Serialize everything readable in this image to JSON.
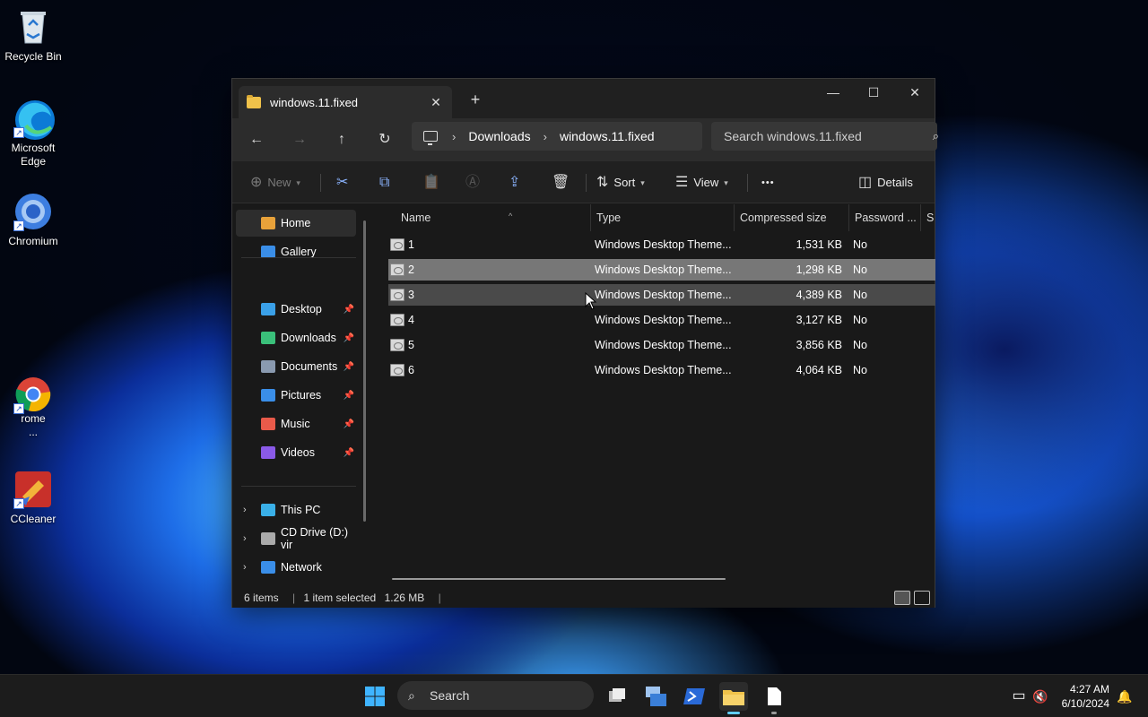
{
  "desktop": {
    "icons": [
      {
        "label": "Recycle Bin",
        "icon": "recycle-bin-icon"
      },
      {
        "label": "Microsoft Edge",
        "icon": "edge-icon"
      },
      {
        "label": "Chromium",
        "icon": "chromium-icon"
      },
      {
        "label": "rome ...",
        "icon": "chrome-icon"
      },
      {
        "label": "CCleaner",
        "icon": "ccleaner-icon"
      }
    ]
  },
  "explorer": {
    "tab_title": "windows.11.fixed",
    "tab_close": "✕",
    "new_tab": "+",
    "caption": {
      "minimize": "—",
      "maximize": "☐",
      "close": "✕"
    },
    "nav": {
      "back": "←",
      "forward": "→",
      "up": "↑",
      "refresh": "↻"
    },
    "breadcrumb": [
      "Downloads",
      "windows.11.fixed"
    ],
    "search_placeholder": "Search windows.11.fixed",
    "commands": {
      "new": "New",
      "sort": "Sort",
      "view": "View",
      "more": "•••",
      "details": "Details",
      "cut": "✂",
      "copy": "⧉",
      "paste": "📋",
      "rename": "Ⓐ",
      "share": "⇪",
      "delete": "🗑"
    },
    "sidebar": {
      "items": [
        {
          "label": "Home",
          "icon": "home-icon",
          "color": "#e8a23a"
        },
        {
          "label": "Gallery",
          "icon": "gallery-icon",
          "color": "#3a8ee8"
        },
        {
          "label": "Desktop",
          "icon": "desktop-folder-icon",
          "color": "#3aa0e8",
          "pinned": true
        },
        {
          "label": "Downloads",
          "icon": "downloads-folder-icon",
          "color": "#3ac07a",
          "pinned": true
        },
        {
          "label": "Documents",
          "icon": "documents-folder-icon",
          "color": "#8a9ab0",
          "pinned": true
        },
        {
          "label": "Pictures",
          "icon": "pictures-folder-icon",
          "color": "#3a8ee8",
          "pinned": true
        },
        {
          "label": "Music",
          "icon": "music-folder-icon",
          "color": "#e85a4a",
          "pinned": true
        },
        {
          "label": "Videos",
          "icon": "videos-folder-icon",
          "color": "#8a5ae8",
          "pinned": true
        },
        {
          "label": "This PC",
          "icon": "this-pc-icon",
          "color": "#3ab0e8"
        },
        {
          "label": "CD Drive (D:) vir",
          "icon": "cd-drive-icon",
          "color": "#aaaaaa"
        },
        {
          "label": "Network",
          "icon": "network-icon",
          "color": "#3a8ee8"
        }
      ],
      "pin_glyph": "📌",
      "expand_glyph": "›"
    },
    "columns": [
      "Name",
      "Type",
      "Compressed size",
      "Password ...",
      "Si"
    ],
    "sort_indicator": "^",
    "files": [
      {
        "name": "1",
        "type": "Windows Desktop Theme...",
        "size": "1,531 KB",
        "password": "No"
      },
      {
        "name": "2",
        "type": "Windows Desktop Theme...",
        "size": "1,298 KB",
        "password": "No"
      },
      {
        "name": "3",
        "type": "Windows Desktop Theme...",
        "size": "4,389 KB",
        "password": "No"
      },
      {
        "name": "4",
        "type": "Windows Desktop Theme...",
        "size": "3,127 KB",
        "password": "No"
      },
      {
        "name": "5",
        "type": "Windows Desktop Theme...",
        "size": "3,856 KB",
        "password": "No"
      },
      {
        "name": "6",
        "type": "Windows Desktop Theme...",
        "size": "4,064 KB",
        "password": "No"
      }
    ],
    "selected_index": 1,
    "hover_index": 2,
    "status": {
      "count": "6 items",
      "selection": "1 item selected",
      "size": "1.26 MB"
    }
  },
  "taskbar": {
    "search_label": "Search",
    "clock_time": "4:27 AM",
    "clock_date": "6/10/2024"
  },
  "colors": {
    "accent": "#60cdff",
    "selection": "#777777"
  }
}
